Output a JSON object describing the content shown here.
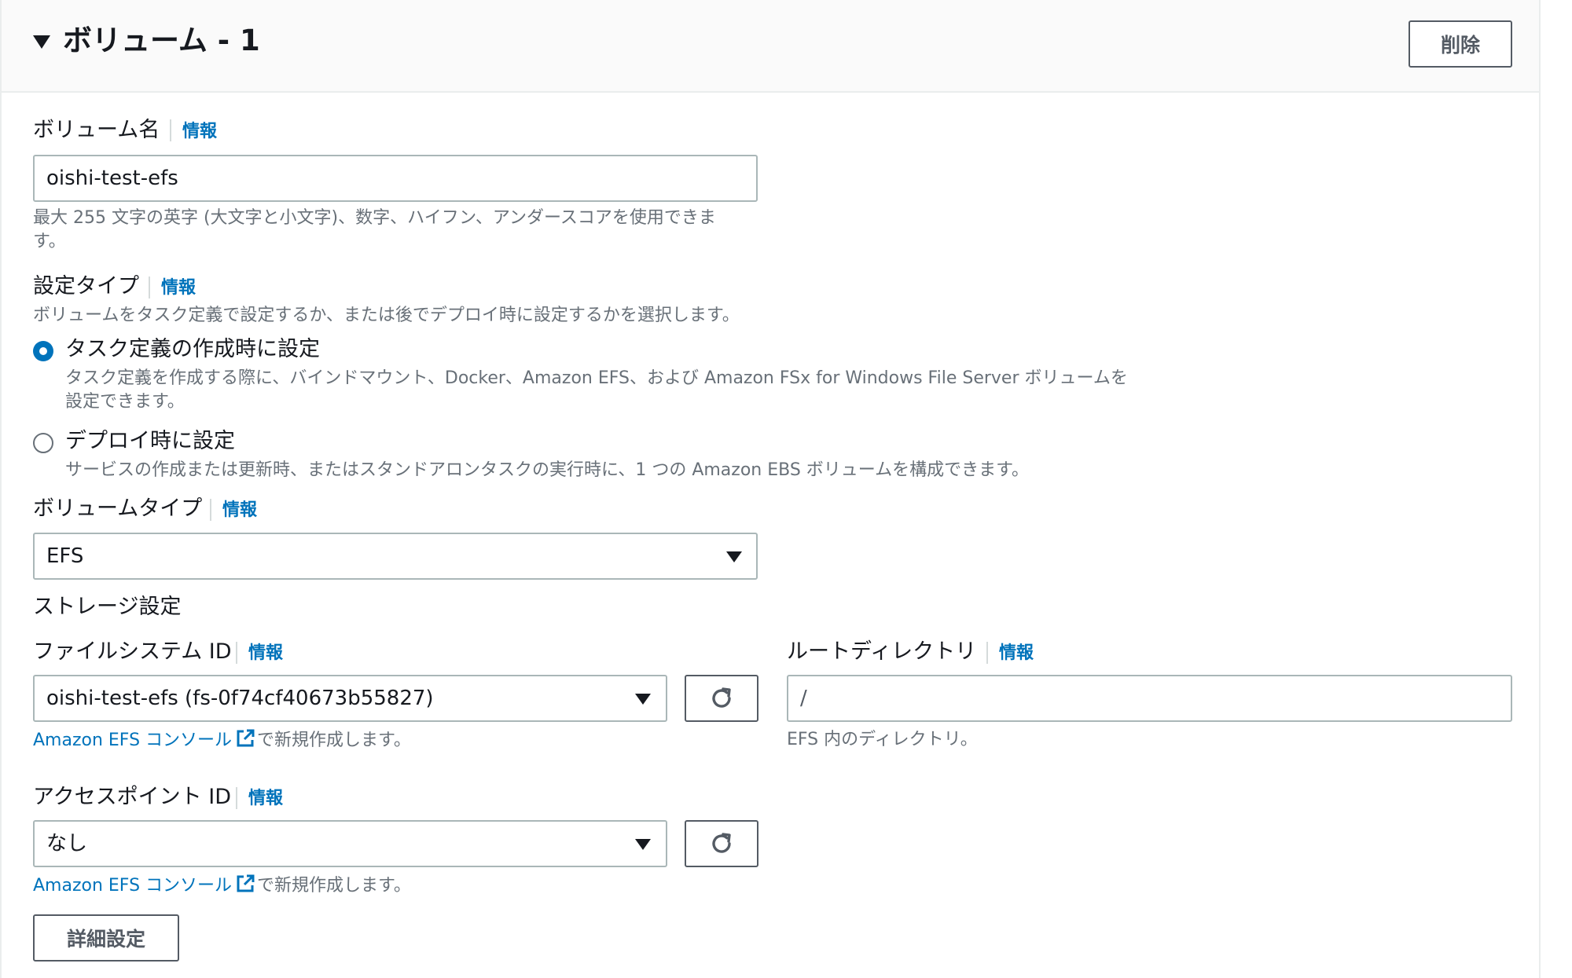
{
  "header": {
    "title": "ボリューム - 1",
    "delete_label": "削除"
  },
  "info_label": "情報",
  "volume_name": {
    "label": "ボリューム名",
    "value": "oishi-test-efs",
    "hint": "最大 255 文字の英字 (大文字と小文字)、数字、ハイフン、アンダースコアを使用できます。"
  },
  "config_type": {
    "label": "設定タイプ",
    "description": "ボリュームをタスク定義で設定するか、または後でデプロイ時に設定するかを選択します。",
    "options": [
      {
        "label": "タスク定義の作成時に設定",
        "description": "タスク定義を作成する際に、バインドマウント、Docker、Amazon EFS、および Amazon FSx for Windows File Server ボリュームを設定できます。",
        "selected": true
      },
      {
        "label": "デプロイ時に設定",
        "description": "サービスの作成または更新時、またはスタンドアロンタスクの実行時に、1 つの Amazon EBS ボリュームを構成できます。",
        "selected": false
      }
    ]
  },
  "volume_type": {
    "label": "ボリュームタイプ",
    "value": "EFS"
  },
  "storage_settings": {
    "heading": "ストレージ設定",
    "file_system_id": {
      "label": "ファイルシステム ID",
      "value": "oishi-test-efs (fs-0f74cf40673b55827)",
      "link_text": "Amazon EFS コンソール",
      "link_suffix": "で新規作成します。"
    },
    "root_directory": {
      "label": "ルートディレクトリ",
      "value": "/",
      "hint": "EFS 内のディレクトリ。"
    },
    "access_point_id": {
      "label": "アクセスポイント ID",
      "value": "なし",
      "link_text": "Amazon EFS コンソール",
      "link_suffix": "で新規作成します。"
    }
  },
  "advanced_button_label": "詳細設定",
  "colors": {
    "link": "#0073bb",
    "text": "#16191f",
    "hint": "#687078",
    "border": "#aab7b8"
  }
}
